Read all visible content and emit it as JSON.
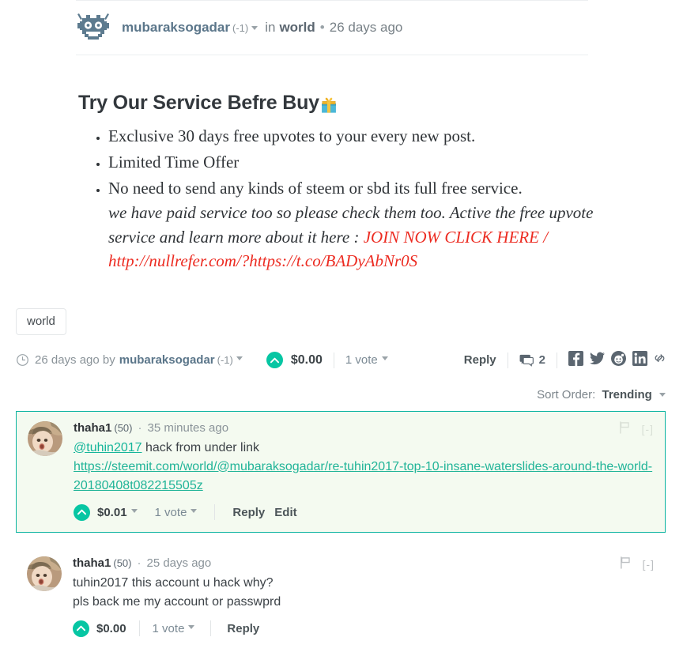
{
  "post": {
    "author": "mubaraksogadar",
    "author_reputation": "(-1)",
    "in_label": "in",
    "category": "world",
    "separator": "•",
    "timestamp": "26 days ago",
    "avatar_icon": "robot-gear-avatar",
    "title": "Try Our Service Befre Buy",
    "title_emoji": "gift-emoji",
    "bullets": [
      "Exclusive 30 days free upvotes to your every new post.",
      "Limited Time Offer"
    ],
    "bullet3_main": "No need to send any kinds of steem or sbd its full free service.",
    "bullet3_italic": "we have paid service too so please check them too. Active the free upvote service and learn more about it here : ",
    "bullet3_link": "JOIN NOW CLICK HERE / http://nullrefer.com/?https://t.co/BADyAbNr0S"
  },
  "tags": [
    "world"
  ],
  "footer": {
    "clock_icon": "clock-icon",
    "timestamp_by": "26 days ago by",
    "author": "mubaraksogadar",
    "author_reputation": "(-1)",
    "upvote_icon": "upvote-arrow-icon",
    "payout": "$0.00",
    "votes": "1 vote",
    "reply_label": "Reply",
    "comment_icon": "comment-bubble-icon",
    "comment_count": "2",
    "share": [
      {
        "name": "facebook-icon",
        "label": "f"
      },
      {
        "name": "twitter-icon",
        "label": "twitter"
      },
      {
        "name": "reddit-icon",
        "label": "reddit"
      },
      {
        "name": "linkedin-icon",
        "label": "in"
      },
      {
        "name": "link-icon",
        "label": "link"
      }
    ]
  },
  "sort": {
    "label": "Sort Order:",
    "value": "Trending"
  },
  "comments": [
    {
      "author": "thaha1",
      "reputation": "(50)",
      "separator": "·",
      "timestamp": "35 minutes ago",
      "mention": "@tuhin2017",
      "text": " hack from under link",
      "url": "https://steemit.com/world/@mubaraksogadar/re-tuhin2017-top-10-insane-waterslides-around-the-world-20180408t082215505z",
      "payout": "$0.01",
      "votes": "1 vote",
      "reply_label": "Reply",
      "edit_label": "Edit",
      "flag_icon": "flag-icon",
      "collapse": "[-]",
      "highlighted": true
    },
    {
      "author": "thaha1",
      "reputation": "(50)",
      "separator": "·",
      "timestamp": "25 days ago",
      "line1": "tuhin2017 this account u hack why?",
      "line2": "pls back me my account or passwprd",
      "payout": "$0.00",
      "votes": "1 vote",
      "reply_label": "Reply",
      "flag_icon": "flag-icon",
      "collapse": "[-]",
      "highlighted": false
    }
  ],
  "colors": {
    "accent_teal": "#06c6a3",
    "highlight_border": "#0ab3a0",
    "highlight_bg": "#f4faf0",
    "link_red": "#ec2b21",
    "link_green": "#21b498",
    "author_blue": "#5b768a"
  }
}
